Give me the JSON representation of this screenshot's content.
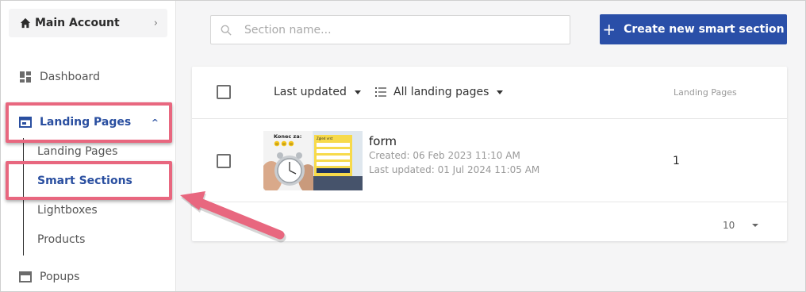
{
  "account": {
    "label": "Main Account"
  },
  "sidebar": {
    "dashboard": "Dashboard",
    "landing_pages": "Landing Pages",
    "sub_items": [
      "Landing Pages",
      "Smart Sections",
      "Lightboxes",
      "Products"
    ],
    "popups": "Popups"
  },
  "search": {
    "placeholder": "Section name..."
  },
  "create_button": {
    "label": "Create new smart section"
  },
  "table": {
    "sort_label": "Last updated",
    "filter_label": "All landing pages",
    "column_landing_pages": "Landing Pages",
    "rows": [
      {
        "name": "form",
        "created": "Created: 06 Feb 2023 11:10 AM",
        "updated": "Last updated: 01 Jul 2024 11:05 AM",
        "landing_pages": "1",
        "thumb_title": "Konec za:",
        "thumb_timer": [
          "00",
          "00",
          "00"
        ],
        "thumb_form_title": "Zgled vrst"
      }
    ],
    "per_page": "10"
  },
  "colors": {
    "accent": "#2a4fa8",
    "active_text": "#2a4fa0",
    "highlight": "#e8677f"
  }
}
